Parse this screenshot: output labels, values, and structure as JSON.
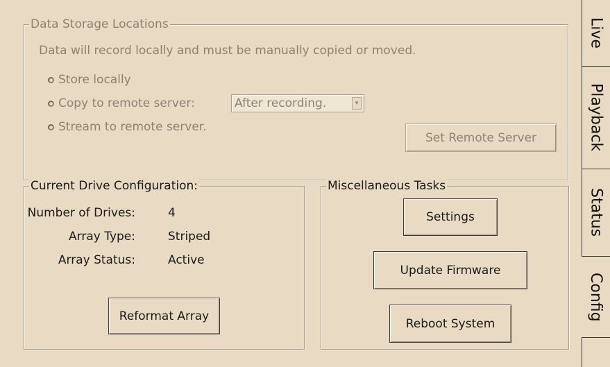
{
  "storage": {
    "title": "Data Storage Locations",
    "description": "Data will record locally and must be manually copied or moved.",
    "options": [
      "Store locally",
      "Copy to remote server:",
      "Stream to remote server."
    ],
    "copy_mode_selected": "After recording.",
    "set_remote_button": "Set Remote Server"
  },
  "drive": {
    "title": "Current Drive Configuration:",
    "number_label": "Number of Drives:",
    "number_value": "4",
    "type_label": "Array Type:",
    "type_value": "Striped",
    "status_label": "Array Status:",
    "status_value": "Active",
    "reformat_button": "Reformat Array"
  },
  "misc": {
    "title": "Miscellaneous Tasks",
    "settings_button": "Settings",
    "firmware_button": "Update Firmware",
    "reboot_button": "Reboot System"
  },
  "tabs": [
    "Live",
    "Playback",
    "Status",
    "Config"
  ],
  "active_tab": "Config"
}
